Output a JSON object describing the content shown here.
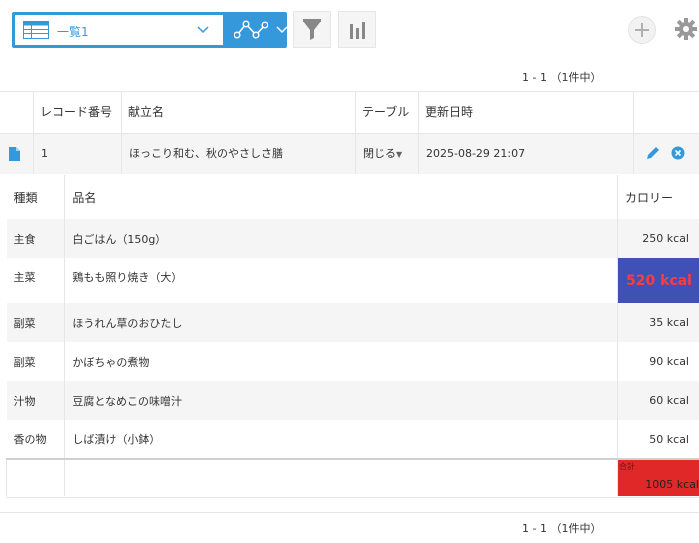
{
  "toolbar": {
    "view_name": "一覧1",
    "icons": [
      "table-icon",
      "chevron-down-icon",
      "graph-icon",
      "chevron-down-icon",
      "filter-icon",
      "bar-chart-icon",
      "plus-icon",
      "gear-icon"
    ]
  },
  "pagination": {
    "text": "1 - 1 （1件中）"
  },
  "columns": {
    "record_no": "レコード番号",
    "menu": "献立名",
    "table": "テーブル",
    "updated": "更新日時"
  },
  "record": {
    "no": "1",
    "menu": "ほっこり和む、秋のやさしさ膳",
    "table": "閉じる",
    "updated": "2025-08-29 21:07"
  },
  "subtable": {
    "headers": {
      "kind": "種類",
      "item": "品名",
      "cal": "カロリー"
    },
    "rows": [
      {
        "kind": "主食",
        "item": "白ごはん（150g）",
        "cal": "250 kcal"
      },
      {
        "kind": "主菜",
        "item": "鶏もも照り焼き（大）",
        "cal": "520 kcal"
      },
      {
        "kind": "副菜",
        "item": "ほうれん草のおひたし",
        "cal": "35 kcal"
      },
      {
        "kind": "副菜",
        "item": "かぼちゃの煮物",
        "cal": "90 kcal"
      },
      {
        "kind": "汁物",
        "item": "豆腐となめこの味噌汁",
        "cal": "60 kcal"
      },
      {
        "kind": "香の物",
        "item": "しば漬け（小鉢）",
        "cal": "50 kcal"
      }
    ],
    "total_label": "合計",
    "total_value": "1005 kcal"
  },
  "colors": {
    "accent": "#3498db",
    "highlight_bg": "#3f51b5",
    "highlight_text": "#ff3c3c",
    "total_bg": "#e02828"
  }
}
